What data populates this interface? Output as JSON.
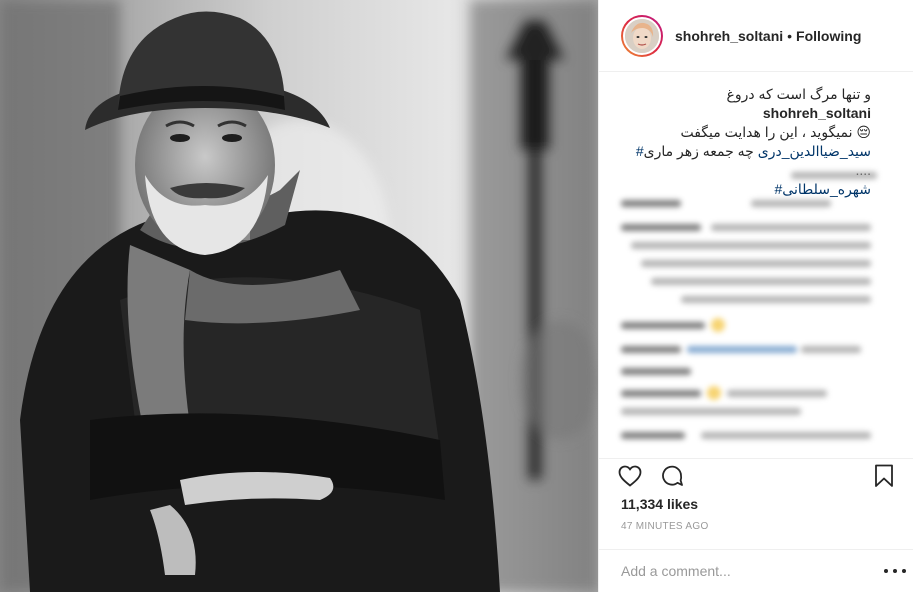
{
  "header": {
    "username": "shohreh_soltani",
    "separator": "•",
    "follow_status": "Following"
  },
  "caption": {
    "username": "shohreh_soltani",
    "line1": "و تنها مرگ است که دروغ",
    "line2": "نمیگوید ، این را هدایت میگفت 😔",
    "line3": "چه جمعه زهر ماری ....",
    "hashtag1": "#سید_ضیاالدین_دری",
    "hashtag2": "#شهره_سلطانی"
  },
  "actions": {
    "like_icon": "heart-icon",
    "comment_icon": "speech-bubble-icon",
    "save_icon": "bookmark-icon"
  },
  "stats": {
    "likes": "11,334 likes",
    "posted": "47 MINUTES AGO"
  },
  "add_comment": {
    "placeholder": "Add a comment..."
  },
  "colors": {
    "text": "#262626",
    "muted": "#999999",
    "link": "#003569",
    "border": "#efefef"
  }
}
